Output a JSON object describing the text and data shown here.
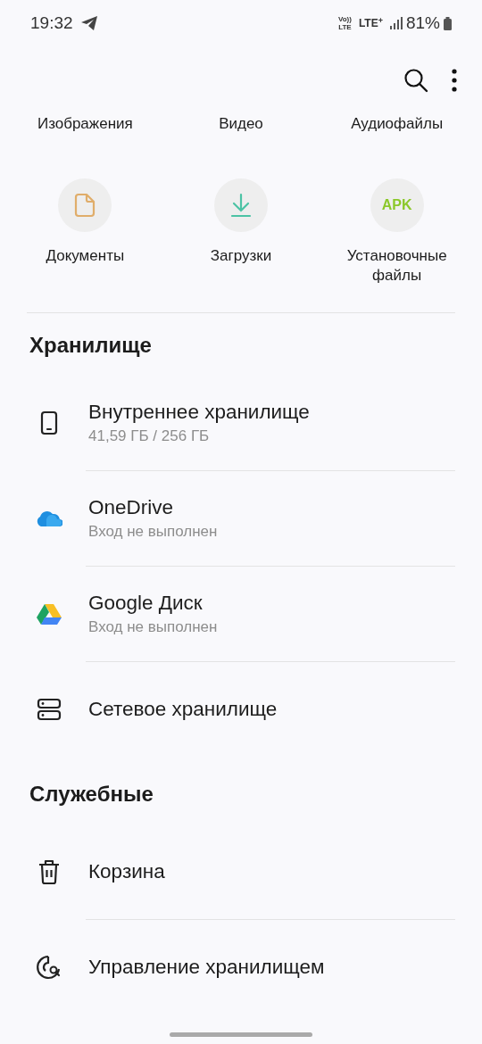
{
  "status_bar": {
    "time": "19:32",
    "volte_top": "Vo))",
    "volte_bottom": "LTE",
    "network": "LTE$^{+}$",
    "battery": "81%"
  },
  "categories": [
    {
      "label": "Изображения",
      "kind": "hidden"
    },
    {
      "label": "Видео",
      "kind": "hidden"
    },
    {
      "label": "Аудиофайлы",
      "kind": "hidden"
    },
    {
      "label": "Документы",
      "kind": "document"
    },
    {
      "label": "Загрузки",
      "kind": "download"
    },
    {
      "label": "Установочные файлы",
      "kind": "apk",
      "badge": "APK"
    }
  ],
  "storage": {
    "heading": "Хранилище",
    "items": [
      {
        "title": "Внутреннее хранилище",
        "subtitle": "41,59 ГБ / 256 ГБ",
        "kind": "phone"
      },
      {
        "title": "OneDrive",
        "subtitle": "Вход не выполнен",
        "kind": "cloud"
      },
      {
        "title": "Google Диск",
        "subtitle": "Вход не выполнен",
        "kind": "drive"
      },
      {
        "title": "Сетевое хранилище",
        "kind": "server"
      }
    ]
  },
  "utilities": {
    "heading": "Служебные",
    "items": [
      {
        "title": "Корзина",
        "kind": "trash"
      },
      {
        "title": "Управление хранилищем",
        "kind": "analyze"
      }
    ]
  }
}
